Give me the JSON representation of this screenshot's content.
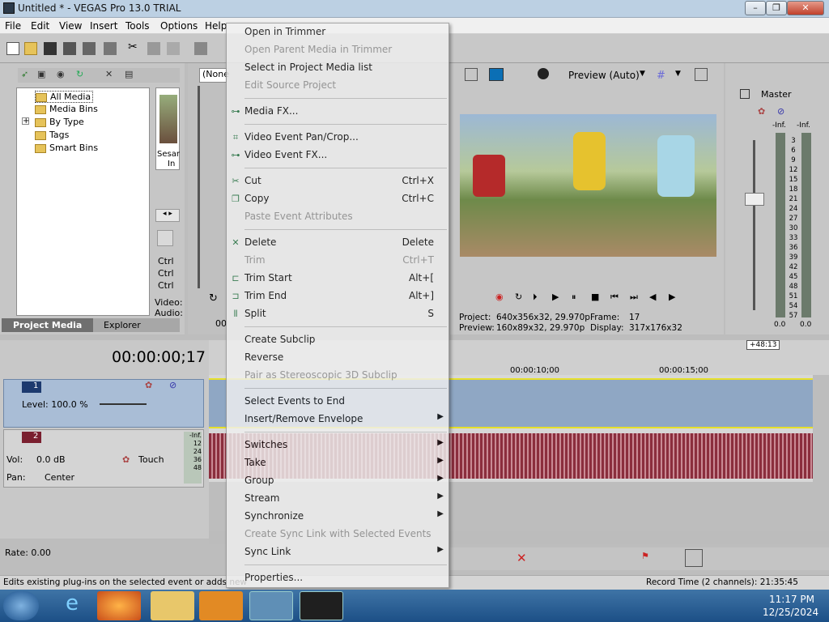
{
  "window": {
    "title": "Untitled * - VEGAS Pro 13.0 TRIAL",
    "minimize": "–",
    "restore": "❐",
    "close": "✕"
  },
  "menubar": [
    "File",
    "Edit",
    "View",
    "Insert",
    "Tools",
    "Options",
    "Help"
  ],
  "explorer": {
    "items": [
      "All Media",
      "Media Bins",
      "By Type",
      "Tags",
      "Smart Bins"
    ],
    "expander": "+"
  },
  "media_strip": {
    "thumb_caption_1": "Sesar",
    "thumb_caption_2": "In",
    "ctrl": [
      "Ctrl",
      "Ctrl",
      "Ctrl"
    ],
    "video": "Video:",
    "audio": "Audio:"
  },
  "tabs": [
    "Project Media",
    "Explorer"
  ],
  "trimmer": {
    "dropdown": "(None",
    "time": "00"
  },
  "preview": {
    "mode": "Preview (Auto)",
    "project": "Project:",
    "project_val": "640x356x32, 29.970p",
    "preview_lbl": "Preview:",
    "preview_val": "160x89x32, 29.970p",
    "frame": "Frame:",
    "frame_val": "17",
    "display": "Display:",
    "display_val": "317x176x32"
  },
  "master": {
    "label": "Master",
    "inf_left": "-Inf.",
    "inf_right": "-Inf.",
    "scale": [
      "3",
      "6",
      "9",
      "12",
      "15",
      "18",
      "21",
      "24",
      "27",
      "30",
      "33",
      "36",
      "39",
      "42",
      "45",
      "48",
      "51",
      "54",
      "57"
    ],
    "zero_left": "0.0",
    "zero_right": "0.0"
  },
  "timeline": {
    "timecode": "00:00:00;17",
    "marker_10": "00:00:10;00",
    "marker_15": "00:00:15;00",
    "offset": "+48:13"
  },
  "track1": {
    "num": "1",
    "level_label": "Level: 100.0 %"
  },
  "track2": {
    "num": "2",
    "vol_label": "Vol:",
    "vol_val": "0.0 dB",
    "pan_label": "Pan:",
    "pan_val": "Center",
    "touch": "Touch",
    "meter": [
      "-Inf.",
      "12",
      "24",
      "36",
      "48"
    ]
  },
  "rate": "Rate: 0.00",
  "status": {
    "left": "Edits existing plug-ins on the selected event or adds new",
    "right": "Record Time (2 channels): 21:35:45"
  },
  "context_menu": [
    {
      "label": "Open in Trimmer",
      "shortcut": "",
      "disabled": false,
      "icon": "",
      "submenu": false
    },
    {
      "label": "Open Parent Media in Trimmer",
      "shortcut": "",
      "disabled": true,
      "icon": "",
      "submenu": false
    },
    {
      "label": "Select in Project Media list",
      "shortcut": "",
      "disabled": false,
      "icon": "",
      "submenu": false
    },
    {
      "label": "Edit Source Project",
      "shortcut": "",
      "disabled": true,
      "icon": "",
      "submenu": false
    },
    {
      "sep": true
    },
    {
      "label": "Media FX...",
      "shortcut": "",
      "disabled": false,
      "icon": "fx-plug-icon",
      "submenu": false
    },
    {
      "sep": true
    },
    {
      "label": "Video Event Pan/Crop...",
      "shortcut": "",
      "disabled": false,
      "icon": "pan-crop-icon",
      "submenu": false
    },
    {
      "label": "Video Event FX...",
      "shortcut": "",
      "disabled": false,
      "icon": "fx-plug-icon",
      "submenu": false
    },
    {
      "sep": true
    },
    {
      "label": "Cut",
      "shortcut": "Ctrl+X",
      "disabled": false,
      "icon": "scissors-icon",
      "submenu": false
    },
    {
      "label": "Copy",
      "shortcut": "Ctrl+C",
      "disabled": false,
      "icon": "copy-icon",
      "submenu": false
    },
    {
      "label": "Paste Event Attributes",
      "shortcut": "",
      "disabled": true,
      "icon": "",
      "submenu": false
    },
    {
      "sep": true
    },
    {
      "label": "Delete",
      "shortcut": "Delete",
      "disabled": false,
      "icon": "delete-icon",
      "submenu": false
    },
    {
      "label": "Trim",
      "shortcut": "Ctrl+T",
      "disabled": true,
      "icon": "",
      "submenu": false
    },
    {
      "label": "Trim Start",
      "shortcut": "Alt+[",
      "disabled": false,
      "icon": "trim-start-icon",
      "submenu": false
    },
    {
      "label": "Trim End",
      "shortcut": "Alt+]",
      "disabled": false,
      "icon": "trim-end-icon",
      "submenu": false
    },
    {
      "label": "Split",
      "shortcut": "S",
      "disabled": false,
      "icon": "split-icon",
      "submenu": false
    },
    {
      "sep": true
    },
    {
      "label": "Create Subclip",
      "shortcut": "",
      "disabled": false,
      "icon": "",
      "submenu": false
    },
    {
      "label": "Reverse",
      "shortcut": "",
      "disabled": false,
      "icon": "",
      "submenu": false
    },
    {
      "label": "Pair as Stereoscopic 3D Subclip",
      "shortcut": "",
      "disabled": true,
      "icon": "",
      "submenu": false
    },
    {
      "sep": true
    },
    {
      "label": "Select Events to End",
      "shortcut": "",
      "disabled": false,
      "icon": "",
      "submenu": false
    },
    {
      "label": "Insert/Remove Envelope",
      "shortcut": "",
      "disabled": false,
      "icon": "",
      "submenu": true
    },
    {
      "sep": true
    },
    {
      "label": "Switches",
      "shortcut": "",
      "disabled": false,
      "icon": "",
      "submenu": true
    },
    {
      "label": "Take",
      "shortcut": "",
      "disabled": false,
      "icon": "",
      "submenu": true
    },
    {
      "label": "Group",
      "shortcut": "",
      "disabled": false,
      "icon": "",
      "submenu": true
    },
    {
      "label": "Stream",
      "shortcut": "",
      "disabled": false,
      "icon": "",
      "submenu": true
    },
    {
      "label": "Synchronize",
      "shortcut": "",
      "disabled": false,
      "icon": "",
      "submenu": true
    },
    {
      "label": "Create Sync Link with Selected Events",
      "shortcut": "",
      "disabled": true,
      "icon": "",
      "submenu": false
    },
    {
      "label": "Sync Link",
      "shortcut": "",
      "disabled": false,
      "icon": "",
      "submenu": true
    },
    {
      "sep": true
    },
    {
      "label": "Properties...",
      "shortcut": "",
      "disabled": false,
      "icon": "",
      "submenu": false
    }
  ],
  "taskbar": {
    "time": "11:17 PM",
    "date": "12/25/2024"
  },
  "colors": {
    "accent": "#3a6ea5",
    "track_video": "#8fa7c4",
    "audio_wave": "#8b2e3d"
  }
}
